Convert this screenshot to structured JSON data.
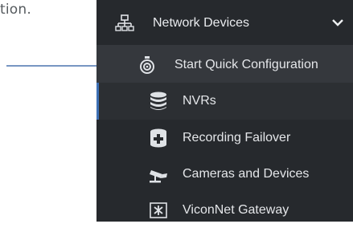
{
  "background_text": "tion.",
  "annotation": {
    "color": "#4a74ad"
  },
  "menu": {
    "background": "#26292d",
    "accent": "#3d6fb4",
    "header": {
      "label": "Network Devices",
      "icon": "network-icon",
      "expand_icon": "chevron-down-icon"
    },
    "items": [
      {
        "label": "Start Quick Configuration",
        "icon": "stopwatch-icon"
      },
      {
        "label": "NVRs",
        "icon": "database-icon",
        "active": true
      },
      {
        "label": "Recording Failover",
        "icon": "failover-icon"
      },
      {
        "label": "Cameras and Devices",
        "icon": "camera-icon"
      },
      {
        "label": "ViconNet Gateway",
        "icon": "gateway-icon"
      }
    ]
  }
}
